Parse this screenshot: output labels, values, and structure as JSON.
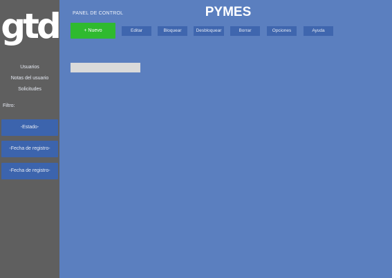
{
  "sidebar": {
    "logo": "gtd",
    "nav": [
      "Usuarios",
      "Notas del usuario",
      "Solicitudes"
    ],
    "filter_label": "Filtro:",
    "filters": [
      "-Estado-",
      "-Fecha de registro-",
      "-Fecha de registro-"
    ]
  },
  "header": {
    "panel_title": "PANEL DE CONTROL",
    "page_title": "PYMES"
  },
  "toolbar": {
    "new_label": "+ Nuevo",
    "buttons": [
      "Editar",
      "Bloquear",
      "Desbloquear",
      "Borrar",
      "Opciones",
      "Ayuda"
    ]
  },
  "search": {
    "value": ""
  },
  "colors": {
    "background": "#5b7fbf",
    "sidebar": "#5f5f5f",
    "button": "#3f66ae",
    "new_button": "#2fba2f"
  }
}
